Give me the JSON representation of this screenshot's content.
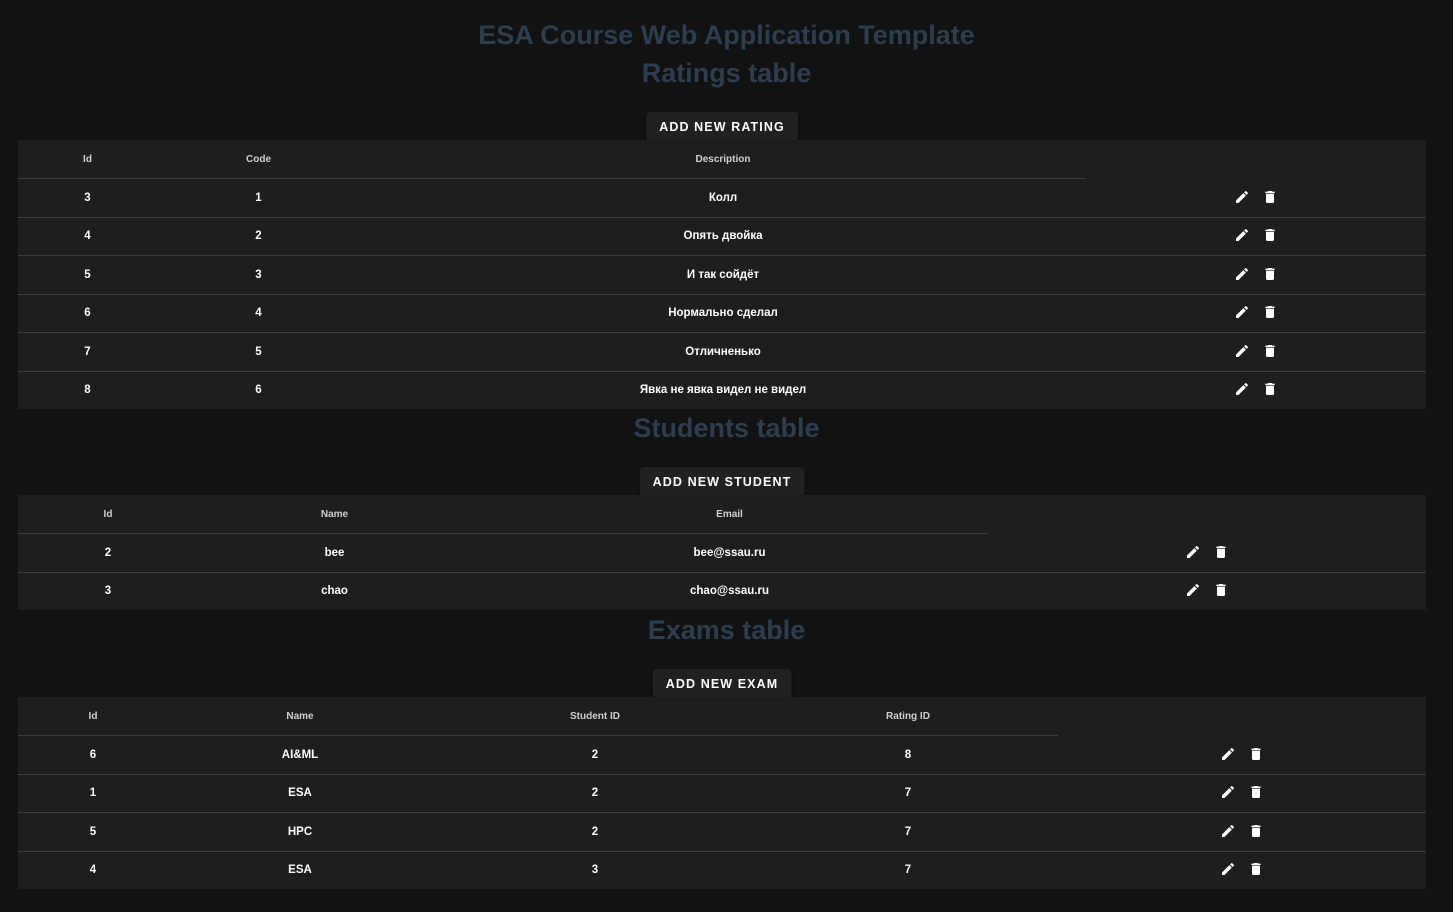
{
  "header": {
    "title": "ESA Course Web Application Template"
  },
  "ratings": {
    "title": "Ratings table",
    "add_label": "ADD NEW RATING",
    "columns": [
      "Id",
      "Code",
      "Description"
    ],
    "rows": [
      [
        "3",
        "1",
        "Колл"
      ],
      [
        "4",
        "2",
        "Опять двойка"
      ],
      [
        "5",
        "3",
        "И так сойдёт"
      ],
      [
        "6",
        "4",
        "Нормально сделал"
      ],
      [
        "7",
        "5",
        "Отличненько"
      ],
      [
        "8",
        "6",
        "Явка не явка видел не видел"
      ]
    ]
  },
  "students": {
    "title": "Students table",
    "add_label": "ADD NEW STUDENT",
    "columns": [
      "Id",
      "Name",
      "Email"
    ],
    "rows": [
      [
        "2",
        "bee",
        "bee@ssau.ru"
      ],
      [
        "3",
        "chao",
        "chao@ssau.ru"
      ]
    ]
  },
  "exams": {
    "title": "Exams table",
    "add_label": "ADD NEW EXAM",
    "columns": [
      "Id",
      "Name",
      "Student ID",
      "Rating ID"
    ],
    "rows": [
      [
        "6",
        "AI&ML",
        "2",
        "8"
      ],
      [
        "1",
        "ESA",
        "2",
        "7"
      ],
      [
        "5",
        "HPC",
        "2",
        "7"
      ],
      [
        "4",
        "ESA",
        "3",
        "7"
      ]
    ]
  },
  "icons": {
    "edit": "pencil-icon",
    "delete": "trash-icon"
  },
  "colors": {
    "background": "#121212",
    "card": "#1e1e1e",
    "heading": "#2c3e50",
    "text": "#ffffff"
  }
}
